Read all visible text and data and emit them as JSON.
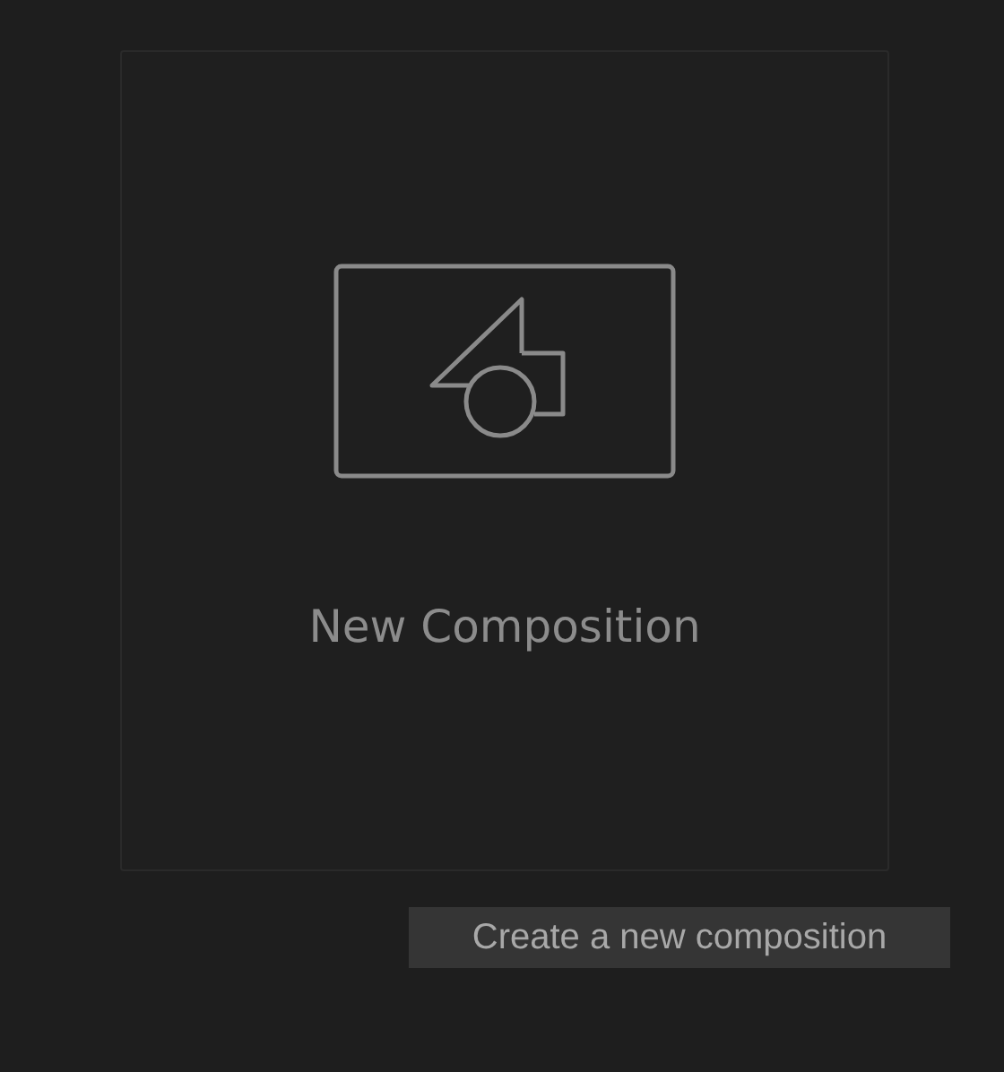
{
  "card": {
    "label": "New Composition"
  },
  "tooltip": {
    "text": "Create a new composition"
  }
}
